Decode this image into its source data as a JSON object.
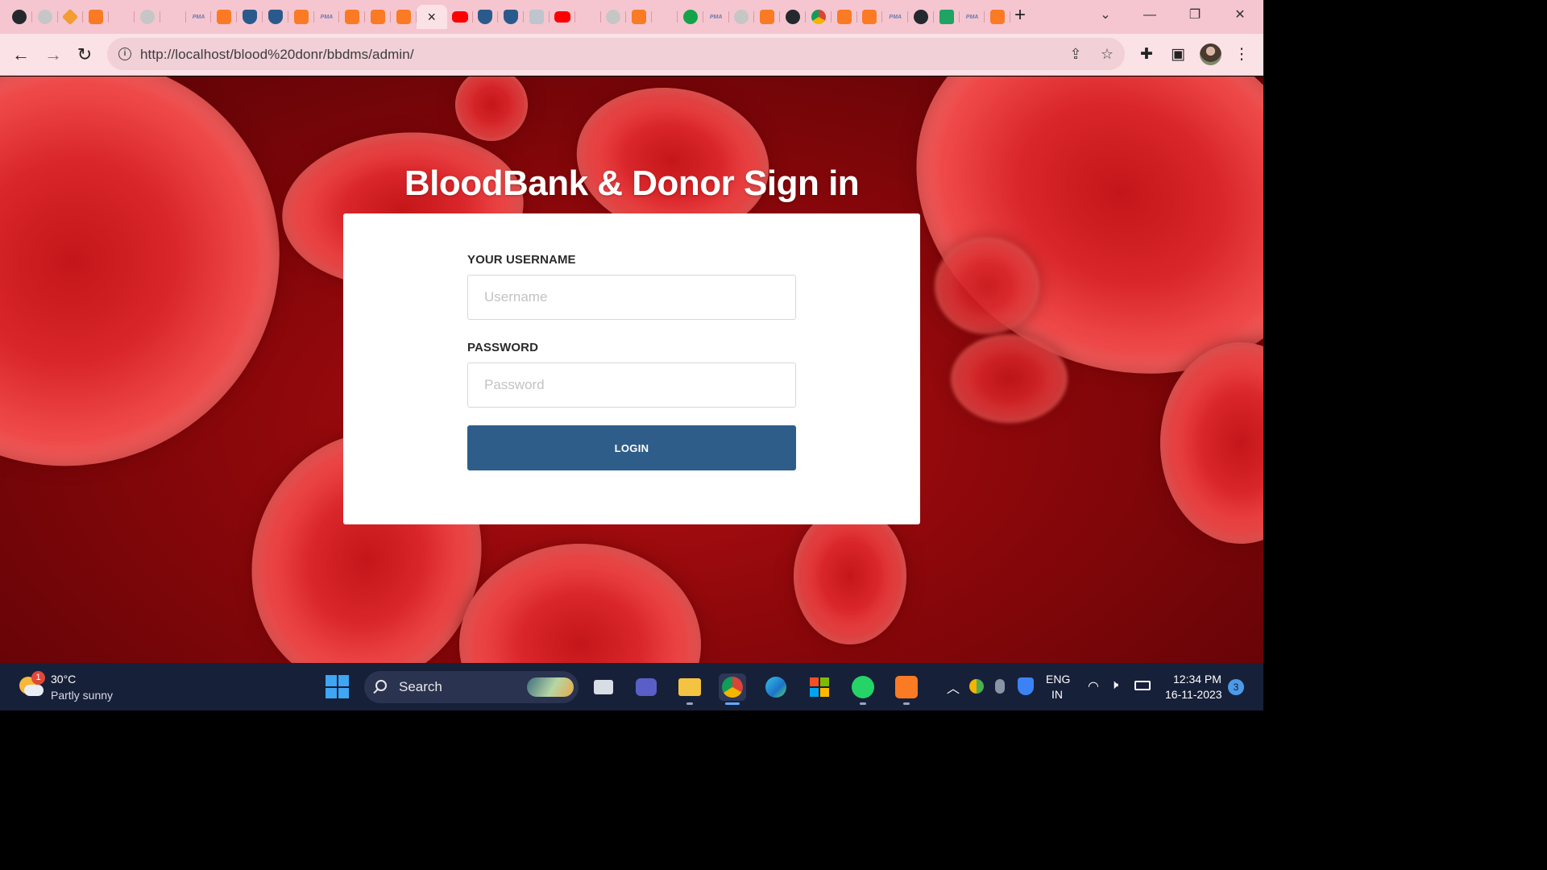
{
  "browser": {
    "tabs": [
      {
        "icon": "github-icon"
      },
      {
        "icon": "globe-icon"
      },
      {
        "icon": "diamond-icon"
      },
      {
        "icon": "xampp-icon"
      },
      {
        "icon": "pen-icon"
      },
      {
        "icon": "globe-icon"
      },
      {
        "icon": "pen-icon"
      },
      {
        "icon": "phpmyadmin-icon"
      },
      {
        "icon": "xampp-icon"
      },
      {
        "icon": "shield-icon"
      },
      {
        "icon": "shield-icon"
      },
      {
        "icon": "xampp-icon"
      },
      {
        "icon": "phpmyadmin-icon"
      },
      {
        "icon": "xampp-icon"
      },
      {
        "icon": "xampp-icon"
      },
      {
        "icon": "xampp-icon"
      },
      {
        "icon": "close-icon",
        "active": true
      },
      {
        "icon": "youtube-icon"
      },
      {
        "icon": "shield-icon"
      },
      {
        "icon": "shield-icon"
      },
      {
        "icon": "app-icon"
      },
      {
        "icon": "youtube-icon"
      },
      {
        "icon": "pen-icon"
      },
      {
        "icon": "globe-icon"
      },
      {
        "icon": "xampp-icon"
      },
      {
        "icon": "pen-icon"
      },
      {
        "icon": "grammarly-icon"
      },
      {
        "icon": "phpmyadmin-icon"
      },
      {
        "icon": "globe-icon"
      },
      {
        "icon": "xampp-icon"
      },
      {
        "icon": "github-icon"
      },
      {
        "icon": "chrome-icon"
      },
      {
        "icon": "xampp-icon"
      },
      {
        "icon": "xampp-icon"
      },
      {
        "icon": "phpmyadmin-icon"
      },
      {
        "icon": "github-icon"
      },
      {
        "icon": "sheets-icon"
      },
      {
        "icon": "phpmyadmin-icon"
      },
      {
        "icon": "xampp-icon"
      }
    ],
    "tab_text": {
      "pma": "PMA",
      "close": "×",
      "new_tab": "+"
    },
    "url": "http://localhost/blood%20donr/bbdms/admin/",
    "accent_color": "#f5c6d0"
  },
  "login": {
    "title": "BloodBank & Donor Sign in",
    "username_label": "YOUR USERNAME",
    "username_placeholder": "Username",
    "username_value": "",
    "password_label": "PASSWORD",
    "password_placeholder": "Password",
    "password_value": "",
    "login_button": "LOGIN",
    "button_color": "#2f5d8a"
  },
  "taskbar": {
    "weather_temp": "30°C",
    "weather_condition": "Partly sunny",
    "weather_badge": "1",
    "search_label": "Search",
    "language_primary": "ENG",
    "language_secondary": "IN",
    "time": "12:34 PM",
    "date": "16-11-2023",
    "notification_count": "3"
  }
}
